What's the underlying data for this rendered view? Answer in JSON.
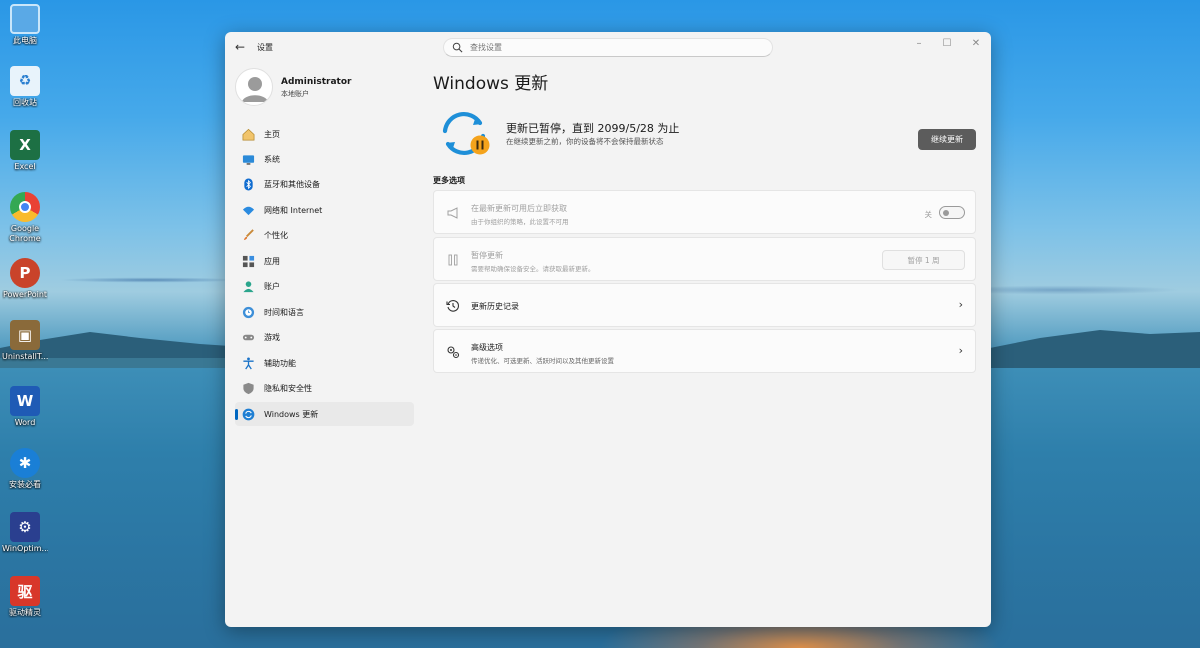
{
  "desktop": {
    "icons": [
      {
        "label": "此电脑",
        "icon": "this-pc-icon",
        "color": "#5aa9e6"
      },
      {
        "label": "回收站",
        "icon": "recycle-bin-icon",
        "color": "#cfe6f5"
      },
      {
        "label": "Excel",
        "icon": "excel-icon",
        "color": "#1d7044",
        "glyph": "X"
      },
      {
        "label": "Google Chrome",
        "icon": "chrome-icon",
        "color": "#e94235"
      },
      {
        "label": "PowerPoint",
        "icon": "powerpoint-icon",
        "color": "#c9432a",
        "glyph": "P"
      },
      {
        "label": "UninstallT...",
        "icon": "uninstall-tool-icon",
        "color": "#8a6a3a"
      },
      {
        "label": "Word",
        "icon": "word-icon",
        "color": "#1f5bb5",
        "glyph": "W"
      },
      {
        "label": "安装必看",
        "icon": "accessibility-app-icon",
        "color": "#1a7fd6"
      },
      {
        "label": "WinOptim...",
        "icon": "win-optimizer-icon",
        "color": "#2a3f8f"
      },
      {
        "label": "驱动精灵",
        "icon": "driver-genius-icon",
        "color": "#d8372a",
        "glyph": "驱"
      }
    ]
  },
  "window": {
    "title": "设置",
    "search_placeholder": "查找设置"
  },
  "profile": {
    "name": "Administrator",
    "account_type": "本地账户"
  },
  "sidebar": {
    "items": [
      {
        "label": "主页",
        "icon": "home-icon"
      },
      {
        "label": "系统",
        "icon": "system-icon"
      },
      {
        "label": "蓝牙和其他设备",
        "icon": "bluetooth-icon"
      },
      {
        "label": "网络和 Internet",
        "icon": "wifi-icon"
      },
      {
        "label": "个性化",
        "icon": "brush-icon"
      },
      {
        "label": "应用",
        "icon": "apps-icon"
      },
      {
        "label": "账户",
        "icon": "account-icon"
      },
      {
        "label": "时间和语言",
        "icon": "time-language-icon"
      },
      {
        "label": "游戏",
        "icon": "gaming-icon"
      },
      {
        "label": "辅助功能",
        "icon": "accessibility-icon"
      },
      {
        "label": "隐私和安全性",
        "icon": "shield-icon"
      },
      {
        "label": "Windows 更新",
        "icon": "windows-update-icon",
        "active": true
      }
    ]
  },
  "main": {
    "title": "Windows 更新",
    "status_title": "更新已暂停，直到 2099/5/28 为止",
    "status_subtitle": "在继续更新之前，你的设备将不会保持最新状态",
    "resume_label": "继续更新",
    "more_options_heading": "更多选项",
    "options": [
      {
        "title": "在最新更新可用后立即获取",
        "subtitle": "由于你组织的策略，此设置不可用",
        "control": "toggle",
        "toggle_label": "关",
        "toggle_on": false,
        "disabled": true
      },
      {
        "title": "暂停更新",
        "subtitle": "需要帮助确保设备安全。请获取最新更新。",
        "control": "button",
        "button_label": "暂停 1 周",
        "disabled": true
      },
      {
        "title": "更新历史记录",
        "subtitle": "",
        "control": "chevron"
      },
      {
        "title": "高级选项",
        "subtitle": "传递优化、可选更新、活跃时间以及其他更新设置",
        "control": "chevron"
      }
    ]
  },
  "colors": {
    "accent": "#0067c0",
    "update_ring": "#1e8fd8",
    "pause_badge": "#f4a31c"
  }
}
